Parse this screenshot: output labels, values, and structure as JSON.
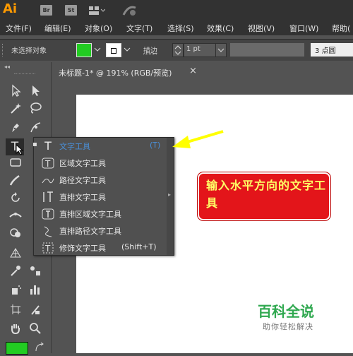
{
  "app": {
    "logo": "Ai",
    "bridge_label": "Br",
    "stock_label": "St"
  },
  "menu": [
    "文件(F)",
    "编辑(E)",
    "对象(O)",
    "文字(T)",
    "选择(S)",
    "效果(C)",
    "视图(V)",
    "窗口(W)",
    "帮助("
  ],
  "controlbar": {
    "selection_status": "未选择对象",
    "fill_color": "#22cc22",
    "stroke_label": "描边",
    "stroke_value": "1 pt",
    "points_label": "3 点圆"
  },
  "document_tab": {
    "title": "未标题-1* @ 191% (RGB/预览)",
    "close": "×"
  },
  "tools": {
    "fill_swatch": "#22cc22"
  },
  "flyout": {
    "items": [
      {
        "label": "文字工具",
        "shortcut": "(T)",
        "selected": true,
        "icon": "type-icon"
      },
      {
        "label": "区域文字工具",
        "shortcut": "",
        "selected": false,
        "icon": "area-type-icon"
      },
      {
        "label": "路径文字工具",
        "shortcut": "",
        "selected": false,
        "icon": "type-on-path-icon"
      },
      {
        "label": "直排文字工具",
        "shortcut": "",
        "selected": false,
        "icon": "vertical-type-icon"
      },
      {
        "label": "直排区域文字工具",
        "shortcut": "",
        "selected": false,
        "icon": "vertical-area-type-icon"
      },
      {
        "label": "直排路径文字工具",
        "shortcut": "",
        "selected": false,
        "icon": "vertical-type-on-path-icon"
      },
      {
        "label": "修饰文字工具",
        "shortcut": "(Shift+T)",
        "selected": false,
        "icon": "touch-type-icon"
      }
    ],
    "highlight_color": "#4a90d9"
  },
  "callout": {
    "text": "输入水平方向的文字工具",
    "color": "#e3151a"
  },
  "watermark": {
    "title": "百科全说",
    "subtitle": "助你轻松解决"
  }
}
